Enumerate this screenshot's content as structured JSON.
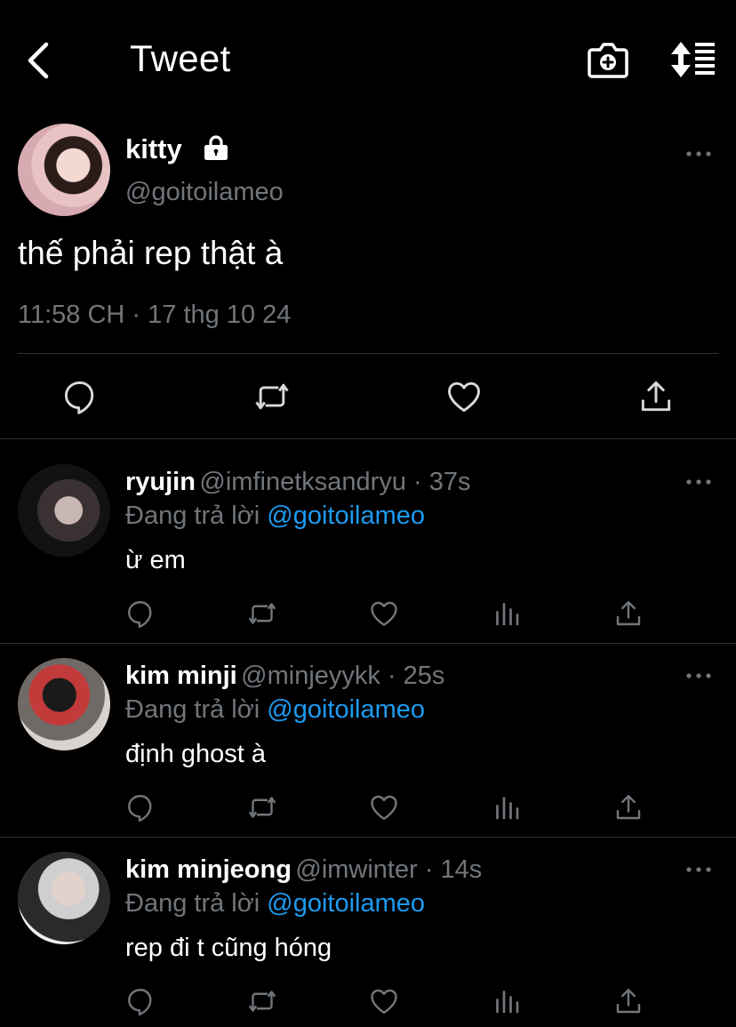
{
  "header": {
    "title": "Tweet",
    "back_icon": "chevron-left-icon",
    "camera_icon": "camera-plus-icon",
    "sort_icon": "sort-icon"
  },
  "main_tweet": {
    "name": "kitty",
    "handle": "@goitoilameo",
    "text": "thế phải rep thật à",
    "time": "11:58 CH · 17 thg 10 24",
    "locked": true
  },
  "replies": [
    {
      "name": "ryujin",
      "handle": "@imfinetksandryu · 37s",
      "replying_prefix": "Đang trả lời",
      "replying_to": "@goitoilameo",
      "text": "ừ em"
    },
    {
      "name": "kim minji",
      "handle": "@minjeyykk · 25s",
      "replying_prefix": "Đang trả lời",
      "replying_to": "@goitoilameo",
      "text": "định ghost à"
    },
    {
      "name": "kim minjeong",
      "handle": "@imwinter · 14s",
      "replying_prefix": "Đang trả lời",
      "replying_to": "@goitoilameo",
      "text": "rep đi t cũng hóng"
    }
  ],
  "colors": {
    "background": "#000000",
    "text": "#ffffff",
    "muted": "#71767b",
    "link": "#1d9bf0",
    "divider": "#2f3336"
  }
}
